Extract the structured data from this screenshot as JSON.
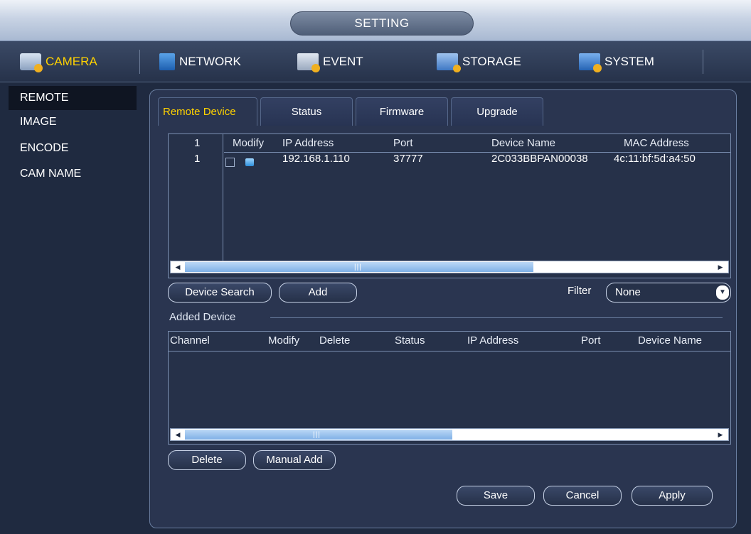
{
  "window": {
    "title": "SETTING"
  },
  "main_tabs": [
    {
      "label": "CAMERA",
      "icon": "camera-icon",
      "active": true
    },
    {
      "label": "NETWORK",
      "icon": "network-icon"
    },
    {
      "label": "EVENT",
      "icon": "event-icon"
    },
    {
      "label": "STORAGE",
      "icon": "storage-icon"
    },
    {
      "label": "SYSTEM",
      "icon": "system-icon"
    }
  ],
  "sidebar": {
    "items": [
      {
        "label": "REMOTE",
        "active": true
      },
      {
        "label": "IMAGE"
      },
      {
        "label": "ENCODE"
      },
      {
        "label": "CAM NAME"
      }
    ]
  },
  "sub_tabs": [
    {
      "label": "Remote Device",
      "active": true
    },
    {
      "label": "Status"
    },
    {
      "label": "Firmware"
    },
    {
      "label": "Upgrade"
    }
  ],
  "search_table": {
    "columns": [
      "1",
      "Modify",
      "IP Address",
      "Port",
      "Device Name",
      "MAC Address"
    ],
    "rows": [
      {
        "index": "1",
        "ip": "192.168.1.110",
        "port": "37777",
        "device_name": "2C033BBPAN00038",
        "mac": "4c:11:bf:5d:a4:50"
      }
    ]
  },
  "buttons": {
    "device_search": "Device Search",
    "add": "Add",
    "delete": "Delete",
    "manual_add": "Manual Add",
    "save": "Save",
    "cancel": "Cancel",
    "apply": "Apply"
  },
  "filter": {
    "label": "Filter",
    "value": "None"
  },
  "added_device": {
    "heading": "Added Device",
    "columns": [
      "Channel",
      "Modify",
      "Delete",
      "Status",
      "IP Address",
      "Port",
      "Device Name"
    ]
  },
  "colors": {
    "accent": "#ffd200",
    "background": "#1f2a40",
    "panel": "#2a3550"
  }
}
